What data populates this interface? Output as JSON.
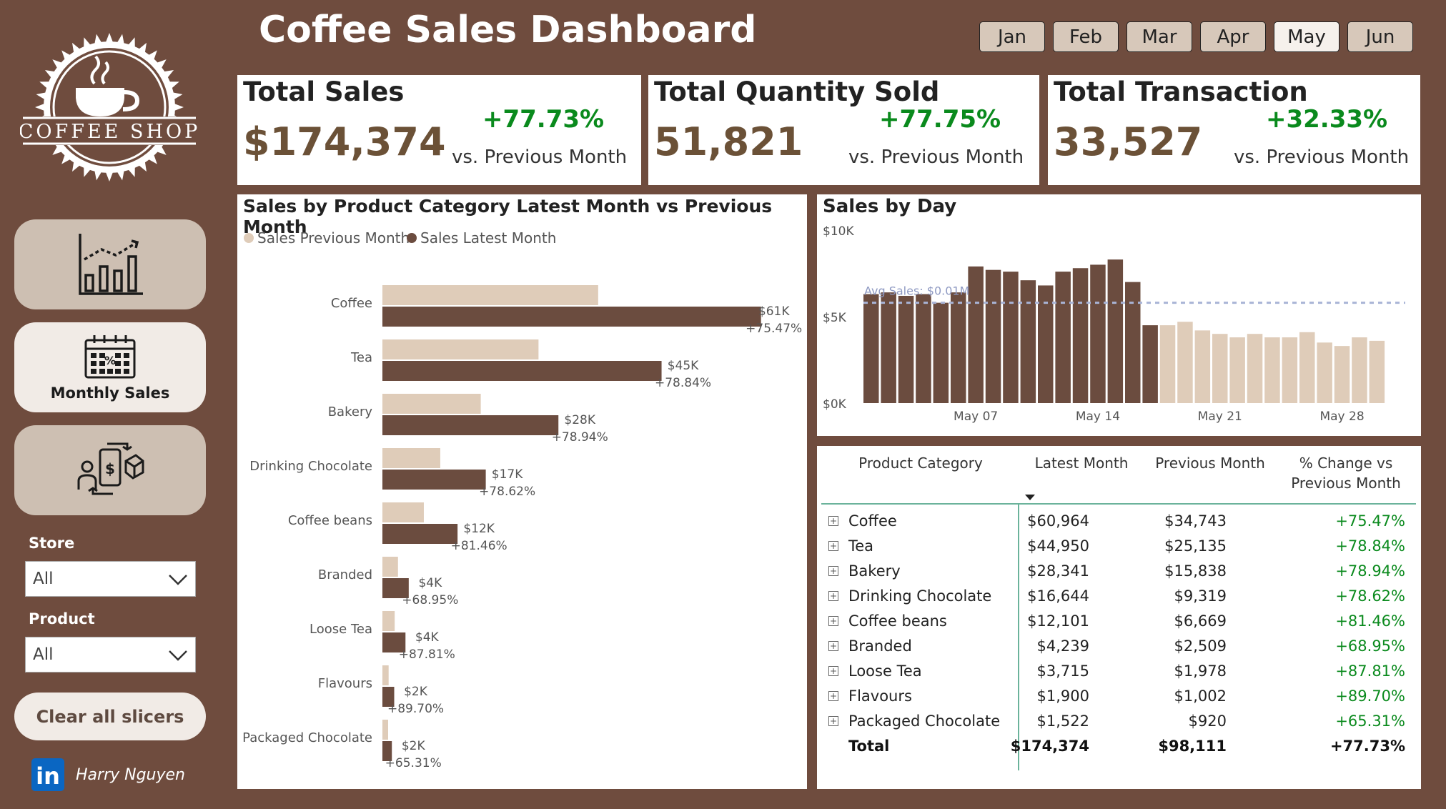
{
  "header": {
    "title": "Coffee Sales Dashboard"
  },
  "months": [
    {
      "label": "Jan",
      "active": false
    },
    {
      "label": "Feb",
      "active": false
    },
    {
      "label": "Mar",
      "active": false
    },
    {
      "label": "Apr",
      "active": false
    },
    {
      "label": "May",
      "active": true
    },
    {
      "label": "Jun",
      "active": false
    }
  ],
  "logo": {
    "text": "COFFEE SHOP"
  },
  "nav": {
    "item1_icon": "bar-chart-icon",
    "item2_icon": "calendar-icon",
    "item2_label": "Monthly Sales",
    "item3_icon": "product-exchange-icon"
  },
  "slicers": {
    "store_title": "Store",
    "store_value": "All",
    "product_title": "Product",
    "product_value": "All"
  },
  "clear_label": "Clear all slicers",
  "author": {
    "logo_text": "in",
    "name": "Harry Nguyen"
  },
  "kpis": {
    "sales": {
      "title": "Total Sales",
      "value": "$174,374",
      "change": "+77.73%",
      "sub": "vs. Previous Month"
    },
    "quantity": {
      "title": "Total Quantity Sold",
      "value": "51,821",
      "change": "+77.75%",
      "sub": "vs. Previous Month"
    },
    "transactions": {
      "title": "Total Transaction",
      "value": "33,527",
      "change": "+32.33%",
      "sub": "vs. Previous Month"
    }
  },
  "colors": {
    "dark_brown": "#6b4c3f",
    "light_tan": "#dfccb9",
    "positive_green": "#0a8a1d",
    "avg_line": "#a9b4d6"
  },
  "chart_data": [
    {
      "type": "bar",
      "orientation": "horizontal",
      "title": "Sales by Product Category Latest Month vs Previous Month",
      "legend": "top-left",
      "categories": [
        "Coffee",
        "Tea",
        "Bakery",
        "Drinking Chocolate",
        "Coffee beans",
        "Branded",
        "Loose Tea",
        "Flavours",
        "Packaged Chocolate"
      ],
      "series": [
        {
          "name": "Sales Previous Month",
          "values": [
            34743,
            25135,
            15838,
            9319,
            6669,
            2509,
            1978,
            1002,
            920
          ]
        },
        {
          "name": "Sales Latest Month",
          "values": [
            60964,
            44950,
            28341,
            16644,
            12101,
            4239,
            3715,
            1900,
            1522
          ]
        }
      ],
      "value_labels": [
        "$61K",
        "$45K",
        "$28K",
        "$17K",
        "$12K",
        "$4K",
        "$4K",
        "$2K",
        "$2K"
      ],
      "pct_labels": [
        "+75.47%",
        "+78.84%",
        "+78.94%",
        "+78.62%",
        "+81.46%",
        "+68.95%",
        "+87.81%",
        "+89.70%",
        "+65.31%"
      ]
    },
    {
      "type": "bar",
      "title": "Sales by Day",
      "ylim": [
        0,
        10000
      ],
      "yticks": [
        "$10K",
        "$5K",
        "$0K"
      ],
      "xticks": [
        "May 07",
        "May 14",
        "May 21",
        "May 28"
      ],
      "avg_label": "Avg Sales: $0.01M",
      "avg_value": 5800,
      "values": [
        6300,
        6400,
        6200,
        6300,
        5800,
        6400,
        7900,
        7700,
        7600,
        7100,
        6800,
        7600,
        7800,
        8000,
        8300,
        7000,
        4500,
        4500,
        4700,
        4200,
        4000,
        3800,
        4000,
        3800,
        3800,
        4100,
        3500,
        3300,
        3800,
        3600
      ],
      "latest_count": 17
    }
  ],
  "table": {
    "headers": [
      "Product Category",
      "Latest Month",
      "Previous Month",
      "% Change vs Previous Month"
    ],
    "rows": [
      {
        "cat": "Coffee",
        "latest": "$60,964",
        "prev": "$34,743",
        "change": "+75.47%"
      },
      {
        "cat": "Tea",
        "latest": "$44,950",
        "prev": "$25,135",
        "change": "+78.84%"
      },
      {
        "cat": "Bakery",
        "latest": "$28,341",
        "prev": "$15,838",
        "change": "+78.94%"
      },
      {
        "cat": "Drinking Chocolate",
        "latest": "$16,644",
        "prev": "$9,319",
        "change": "+78.62%"
      },
      {
        "cat": "Coffee beans",
        "latest": "$12,101",
        "prev": "$6,669",
        "change": "+81.46%"
      },
      {
        "cat": "Branded",
        "latest": "$4,239",
        "prev": "$2,509",
        "change": "+68.95%"
      },
      {
        "cat": "Loose Tea",
        "latest": "$3,715",
        "prev": "$1,978",
        "change": "+87.81%"
      },
      {
        "cat": "Flavours",
        "latest": "$1,900",
        "prev": "$1,002",
        "change": "+89.70%"
      },
      {
        "cat": "Packaged Chocolate",
        "latest": "$1,522",
        "prev": "$920",
        "change": "+65.31%"
      }
    ],
    "total": {
      "cat": "Total",
      "latest": "$174,374",
      "prev": "$98,111",
      "change": "+77.73%"
    }
  }
}
